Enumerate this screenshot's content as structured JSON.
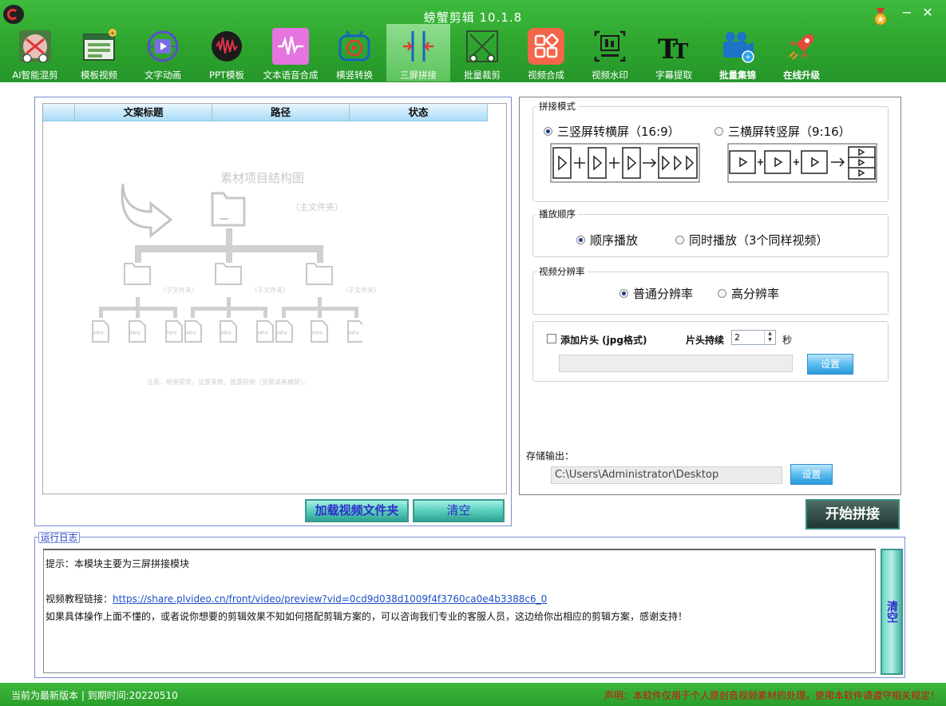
{
  "window": {
    "title": "螃蟹剪辑 10.1.8",
    "minimize_glyph": "−",
    "close_glyph": "✕"
  },
  "toolbar": {
    "items": [
      {
        "label": "AI智能混剪",
        "icon": "ai-mix-icon"
      },
      {
        "label": "模板视频",
        "icon": "template-video-icon"
      },
      {
        "label": "文字动画",
        "icon": "text-animation-icon"
      },
      {
        "label": "PPT模板",
        "icon": "ppt-template-icon"
      },
      {
        "label": "文本语音合成",
        "icon": "text-to-speech-icon"
      },
      {
        "label": "横竖转换",
        "icon": "orientation-convert-icon"
      },
      {
        "label": "三屏拼接",
        "icon": "three-screen-join-icon"
      },
      {
        "label": "批量裁剪",
        "icon": "batch-crop-icon"
      },
      {
        "label": "视频合成",
        "icon": "video-compose-icon"
      },
      {
        "label": "视频水印",
        "icon": "video-watermark-icon"
      },
      {
        "label": "字幕提取",
        "icon": "subtitle-extract-icon"
      },
      {
        "label": "批量集锦",
        "icon": "batch-highlight-icon"
      },
      {
        "label": "在线升级",
        "icon": "online-upgrade-icon"
      }
    ],
    "active_index": 6
  },
  "table": {
    "columns": [
      "文案标题",
      "路径",
      "状态"
    ]
  },
  "diagram": {
    "title": "素材项目结构图",
    "main_folder": "（主文件夹）",
    "sub_folder": "（子文件夹）",
    "file_label": "MP4",
    "note": "注意：根据需求，设置参数，放置视频（竖屏或者横屏）。"
  },
  "left_buttons": {
    "load_folder": "加载视频文件夹",
    "clear": "清空"
  },
  "join_mode": {
    "legend": "拼接模式",
    "options": [
      "三竖屏转横屏（16:9）",
      "三横屏转竖屏（9:16）"
    ],
    "selected": 0
  },
  "play_order": {
    "legend": "播放顺序",
    "options": [
      "顺序播放",
      "同时播放（3个同样视频）"
    ],
    "selected": 0
  },
  "resolution": {
    "legend": "视频分辨率",
    "options": [
      "普通分辨率",
      "高分辨率"
    ],
    "selected": 0
  },
  "intro": {
    "checkbox_label": "添加片头 (jpg格式)",
    "checked": false,
    "duration_label": "片头持续",
    "duration_value": "2",
    "unit": "秒",
    "path_value": "",
    "set_button": "设置"
  },
  "output": {
    "label": "存储输出：",
    "path": "C:\\Users\\Administrator\\Desktop",
    "set_button": "设置"
  },
  "start_button": "开始拼接",
  "log": {
    "legend": "运行日志",
    "line1": "提示：本模块主要为三屏拼接模块",
    "tutorial_prefix": "视频教程链接：",
    "tutorial_link": "https://share.plvideo.cn/front/video/preview?vid=0cd9d038d1009f4f3760ca0e4b3388c6_0",
    "line3": "如果具体操作上面不懂的，或者说你想要的剪辑效果不知如何搭配剪辑方案的，可以咨询我们专业的客服人员，这边给你出相应的剪辑方案，感谢支持！",
    "clear_button": "清空"
  },
  "status": {
    "left": "当前为最新版本 | 到期时间:20220510",
    "right": "声明：本软件仅用于个人原创音视频素材的处理，使用本软件请遵守相关规定！"
  },
  "colors": {
    "title_green": "#2ea52e",
    "teal_button": "#5fd2c1",
    "blue_button": "#5bbcef",
    "link_blue": "#1b50c6",
    "warning_red": "#d01010"
  }
}
